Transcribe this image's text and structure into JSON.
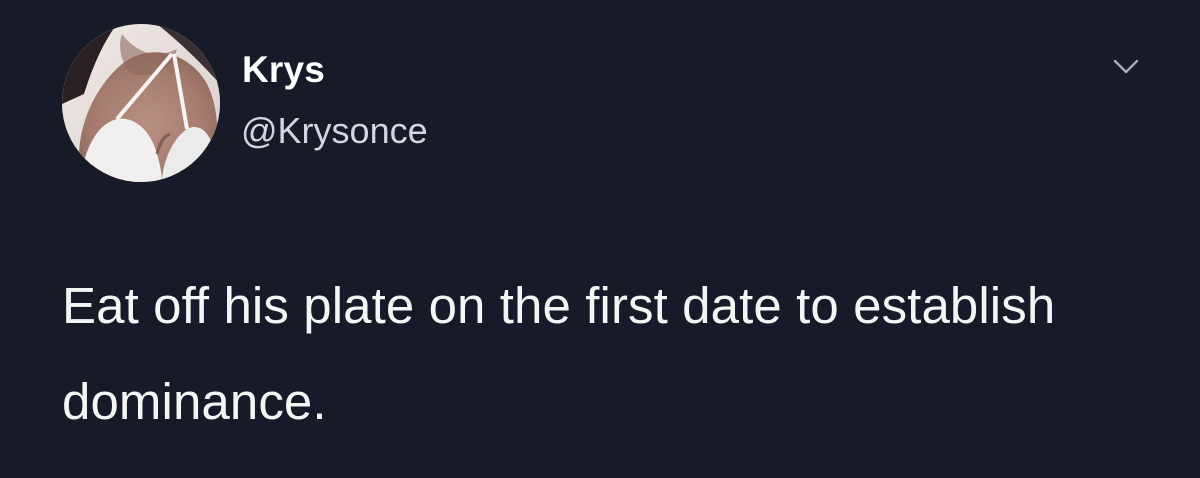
{
  "tweet": {
    "author": {
      "display_name": "Krys",
      "handle": "@Krysonce",
      "avatar": "profile-photo"
    },
    "menu_icon": "chevron-down-icon",
    "text": "Eat off his plate on the first date to establish dominance."
  },
  "colors": {
    "background": "#161a29",
    "primary_text": "#ffffff",
    "secondary_text": "#d3d6dc",
    "icon": "#a6acb8"
  }
}
